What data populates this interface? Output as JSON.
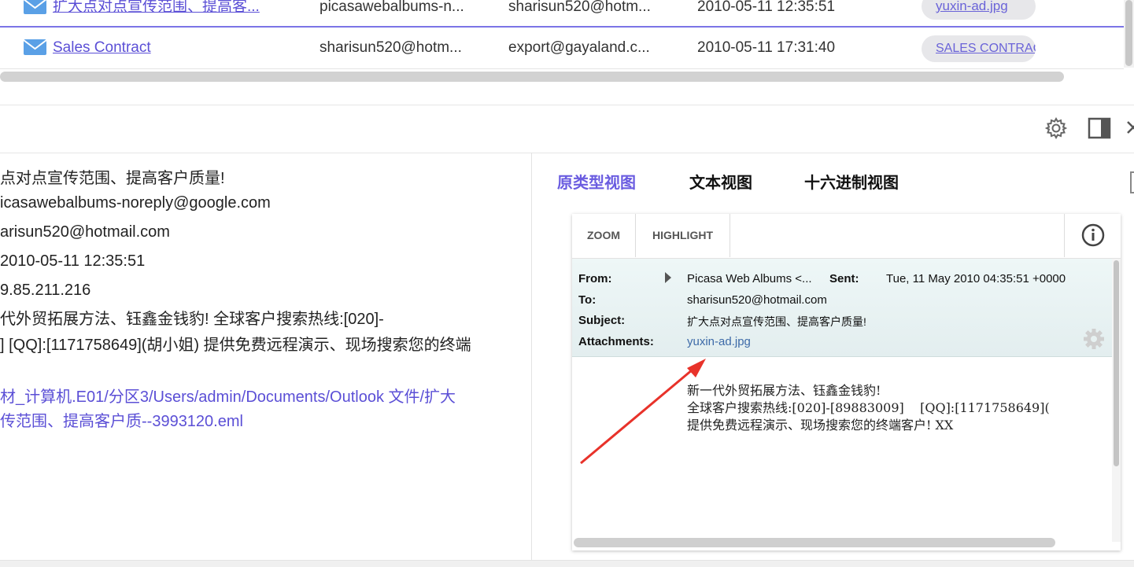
{
  "email_list": {
    "rows": [
      {
        "subject": "扩大点对点宣传范围、提高客...",
        "from": "picasawebalbums-n...",
        "to": "sharisun520@hotm...",
        "date": "2010-05-11 12:35:51",
        "attachment": "yuxin-ad.jpg"
      },
      {
        "subject": "Sales Contract",
        "from": "sharisun520@hotm...",
        "to": "export@gayaland.c...",
        "date": "2010-05-11 17:31:40",
        "attachment": "SALES CONTRACT"
      }
    ]
  },
  "toolbar": {
    "icons": [
      "gear-icon",
      "panel-toggle-icon",
      "close-icon"
    ]
  },
  "detail": {
    "subject": "点对点宣传范围、提高客户质量!",
    "from": "icasawebalbums-noreply@google.com",
    "to": "arisun520@hotmail.com",
    "date": "2010-05-11 12:35:51",
    "ip": "9.85.211.216",
    "body": "代外贸拓展方法、钰鑫金钱豹!   全球客户搜索热线:[020]-\n] [QQ]:[1171758649](胡小姐) 提供免费远程演示、现场搜索您的终端",
    "path": "材_计算机.E01/分区3/Users/admin/Documents/Outlook 文件/扩大\n传范围、提高客户质--3993120.eml"
  },
  "view_tabs": {
    "prototype": "原类型视图",
    "text": "文本视图",
    "hex": "十六进制视图"
  },
  "viewer": {
    "zoom_label": "ZOOM",
    "highlight_label": "HIGHLIGHT",
    "header": {
      "from_label": "From:",
      "from_value": "Picasa Web Albums <...",
      "sent_label": "Sent:",
      "sent_value": "Tue, 11 May 2010 04:35:51 +0000",
      "to_label": "To:",
      "to_value": "sharisun520@hotmail.com",
      "subject_label": "Subject:",
      "subject_value": "扩大点对点宣传范围、提高客户质量!",
      "attachments_label": "Attachments:",
      "attachments_value": "yuxin-ad.jpg"
    },
    "body": "新一代外贸拓展方法、钰鑫金钱豹!\n全球客户搜索热线:[020]-[89883009]    [QQ]:[1171758649](\n提供免费远程演示、现场搜索您的终端客户! XX"
  },
  "colors": {
    "accent": "#6a5ce0",
    "link": "#5b4fd6",
    "annotation_arrow": "#e8322a"
  }
}
